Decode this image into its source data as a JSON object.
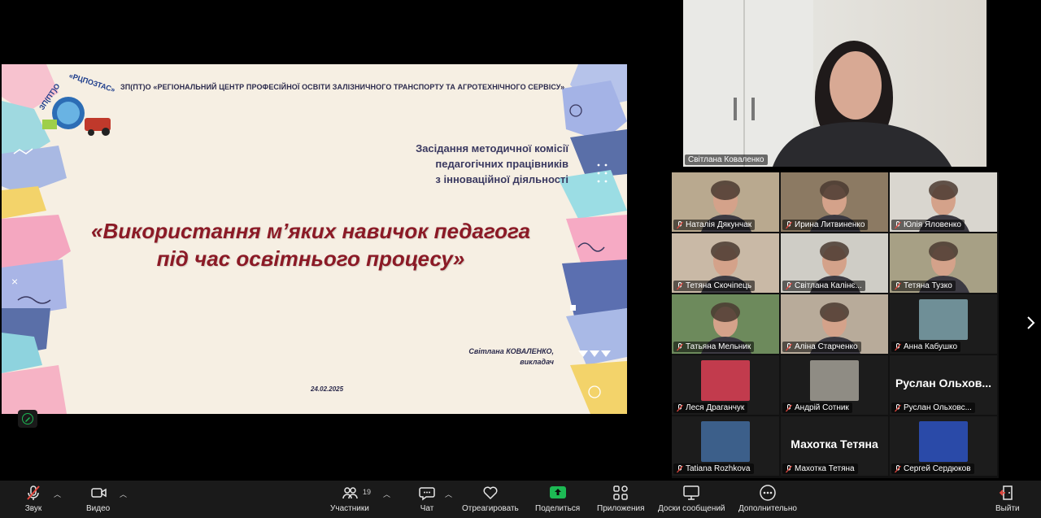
{
  "slide": {
    "org_name": "ЗП(ПТ)О «РЕГІОНАЛЬНИЙ ЦЕНТР  ПРОФЕСІЙНОЇ ОСВІТИ ЗАЛІЗНИЧНОГО ТРАНСПОРТУ  ТА АГРОТЕХНІЧНОГО СЕРВІСУ»",
    "logo_text": "ЗП(ПТ)О «РЦПОЗТАС»",
    "meeting_lines": [
      "Засідання методичної комісії",
      "педагогічних працівників",
      "з інноваційної діяльності"
    ],
    "title_lines": [
      "«Використання м’яких  навичок педагога",
      "під час освітнього процесу»"
    ],
    "author_name": "Світлана КОВАЛЕНКО,",
    "author_role": "викладач",
    "date": "24.02.2025"
  },
  "speaker": {
    "name": "Світлана Коваленко"
  },
  "gallery": [
    {
      "name": "Наталія Дякунчак",
      "kind": "video",
      "bg": "#b9a98f"
    },
    {
      "name": "Ирина Литвиненко",
      "kind": "video",
      "bg": "#8c7a63"
    },
    {
      "name": "Юлія Яловенко",
      "kind": "video",
      "bg": "#d9d6cf"
    },
    {
      "name": "Тетяна Скочіпець",
      "kind": "video",
      "bg": "#c9b9a6"
    },
    {
      "name": "Світлана Калінє...",
      "kind": "video",
      "bg": "#cfcdc6"
    },
    {
      "name": "Тетяна Тузко",
      "kind": "video",
      "bg": "#a7a085"
    },
    {
      "name": "Татьяна Мельник",
      "kind": "video",
      "bg": "#6d8a5c"
    },
    {
      "name": "Аліна Старченко",
      "kind": "video",
      "bg": "#b8ab9a"
    },
    {
      "name": "Анна Кабушко",
      "kind": "avatar",
      "bg": "#1c1c1c",
      "pic": "#6f8f97"
    },
    {
      "name": "Леся Драганчук",
      "kind": "avatar",
      "bg": "#1c1c1c",
      "pic": "#c23b4d"
    },
    {
      "name": "Андрій Сотник",
      "kind": "avatar",
      "bg": "#1c1c1c",
      "pic": "#8f8c84"
    },
    {
      "name": "Руслан Ольховс...",
      "kind": "text",
      "bg": "#1c1c1c",
      "display": "Руслан  Ольхов..."
    },
    {
      "name": "Tatiana Rozhkova",
      "kind": "avatar",
      "bg": "#1c1c1c",
      "pic": "#3c5f8a"
    },
    {
      "name": "Махотка Тетяна",
      "kind": "text",
      "bg": "#1c1c1c",
      "display": "Махотка Тетяна"
    },
    {
      "name": "Сергей Сердюков",
      "kind": "avatar",
      "bg": "#1c1c1c",
      "pic": "#2a4aa8"
    }
  ],
  "toolbar": {
    "audio": "Звук",
    "video": "Видео",
    "participants": "Участники",
    "participants_count": "19",
    "chat": "Чат",
    "react": "Отреагировать",
    "share": "Поделиться",
    "apps": "Приложения",
    "whiteboards": "Доски сообщений",
    "more": "Дополнительно",
    "leave": "Выйти"
  },
  "colors": {
    "share_green": "#1db954",
    "leave_red": "#e5483f",
    "title_red": "#8b1a26"
  }
}
